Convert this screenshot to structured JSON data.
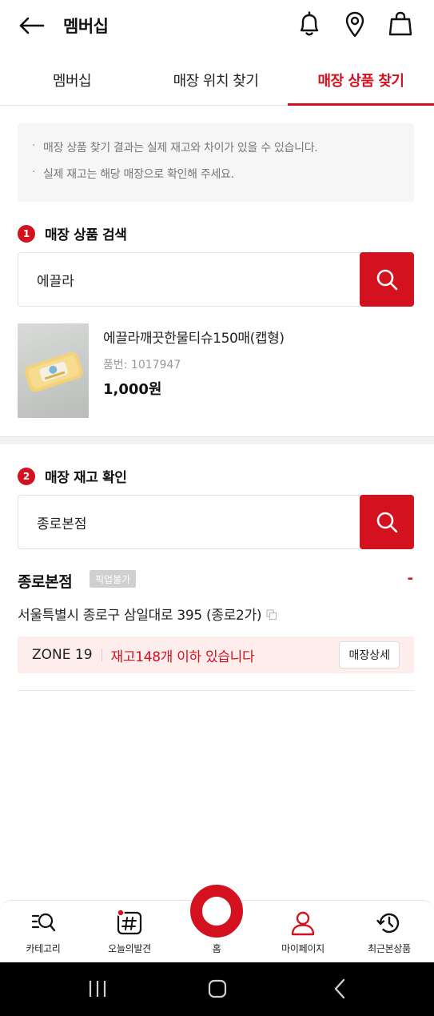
{
  "header": {
    "title": "멤버십"
  },
  "tabs": [
    {
      "label": "멤버십"
    },
    {
      "label": "매장 위치 찾기"
    },
    {
      "label": "매장 상품 찾기"
    }
  ],
  "notice": {
    "lines": [
      "매장 상품 찾기 결과는 실제 재고와 차이가 있을 수 있습니다.",
      "실제 재고는 해당 매장으로 확인해 주세요."
    ]
  },
  "product_search": {
    "step": "1",
    "title": "매장 상품 검색",
    "query": "에끌라"
  },
  "product": {
    "name": "에끌라깨끗한물티슈150매(캡형)",
    "code": "품번: 1017947",
    "price": "1,000원"
  },
  "stock_check": {
    "step": "2",
    "title": "매장 재고 확인",
    "query": "종로본점"
  },
  "store": {
    "name": "종로본점",
    "badge": "픽업불가",
    "distance": "-",
    "address": "서울특별시 종로구 삼일대로 395 (종로2가)",
    "zone": "ZONE 19",
    "stock_text": "재고148개 이하 있습니다",
    "detail_button": "매장상세"
  },
  "bottom_nav": [
    {
      "label": "카테고리",
      "icon": "category-search-icon"
    },
    {
      "label": "오늘의발견",
      "icon": "hashtag-icon"
    },
    {
      "label": "홈",
      "icon": "home-ring-icon"
    },
    {
      "label": "마이페이지",
      "icon": "person-icon"
    },
    {
      "label": "최근본상품",
      "icon": "history-icon"
    }
  ],
  "colors": {
    "accent": "#d4111e",
    "zone_bg": "#fdeeed",
    "notice_bg": "#f6f6f6"
  }
}
